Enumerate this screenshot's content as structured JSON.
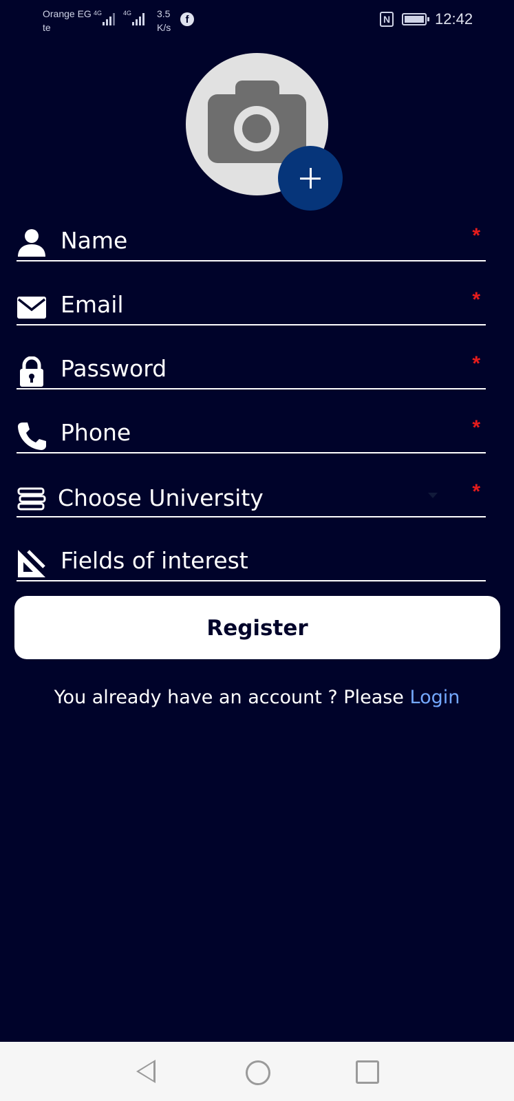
{
  "status_bar": {
    "carrier_line1": "Orange EG",
    "carrier_line2": "te",
    "network1": "4G",
    "network2": "4G",
    "speed_value": "3.5",
    "speed_unit": "K/s",
    "facebook_glyph": "f",
    "nfc_glyph": "N",
    "time": "12:42"
  },
  "avatar": {
    "icon": "camera-icon",
    "add_icon": "plus-icon"
  },
  "form": {
    "fields": [
      {
        "label": "Name",
        "icon": "person-icon",
        "required": true
      },
      {
        "label": "Email",
        "icon": "envelope-icon",
        "required": true
      },
      {
        "label": "Password",
        "icon": "lock-icon",
        "required": true
      },
      {
        "label": "Phone",
        "icon": "phone-icon",
        "required": true
      },
      {
        "label": "Choose University",
        "icon": "books-icon",
        "required": true
      },
      {
        "label": "Fields of interest",
        "icon": "set-square-icon",
        "required": false
      }
    ],
    "required_mark": "*",
    "register_label": "Register",
    "login_prompt": "You already have an account ? Please",
    "login_link": "Login"
  },
  "colors": {
    "background": "#00032a",
    "accent": "#06357a",
    "required": "#e51c1c",
    "link": "#74a8ff"
  }
}
